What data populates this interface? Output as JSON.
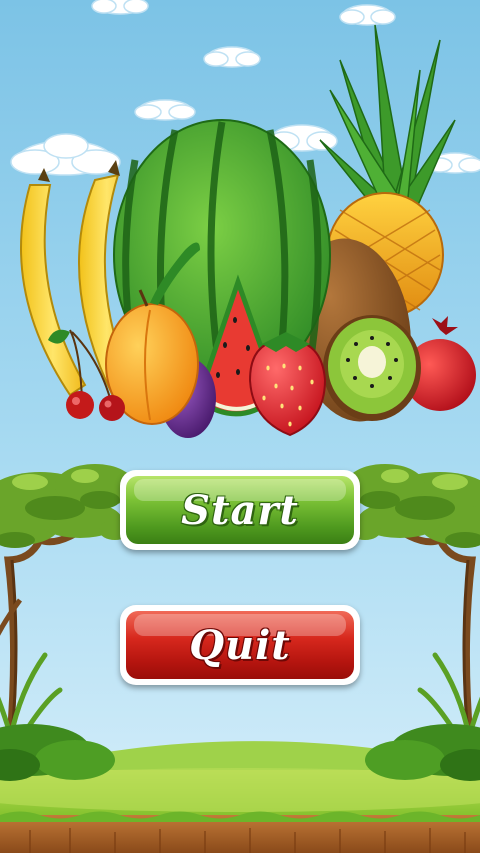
{
  "screen": "main-menu",
  "menu": {
    "start_label": "Start",
    "quit_label": "Quit"
  },
  "scene": {
    "fruits": [
      "banana",
      "watermelon",
      "pineapple",
      "kiwi",
      "apricot",
      "plum",
      "cherry",
      "strawberry",
      "pomegranate",
      "watermelon-slice"
    ]
  },
  "colors": {
    "sky_top": "#7fc6e8",
    "sky_bottom": "#d6eef8",
    "start_button": "#5aa82a",
    "quit_button": "#c21a12",
    "grass": "#6cb52a",
    "soil": "#a05a24"
  }
}
